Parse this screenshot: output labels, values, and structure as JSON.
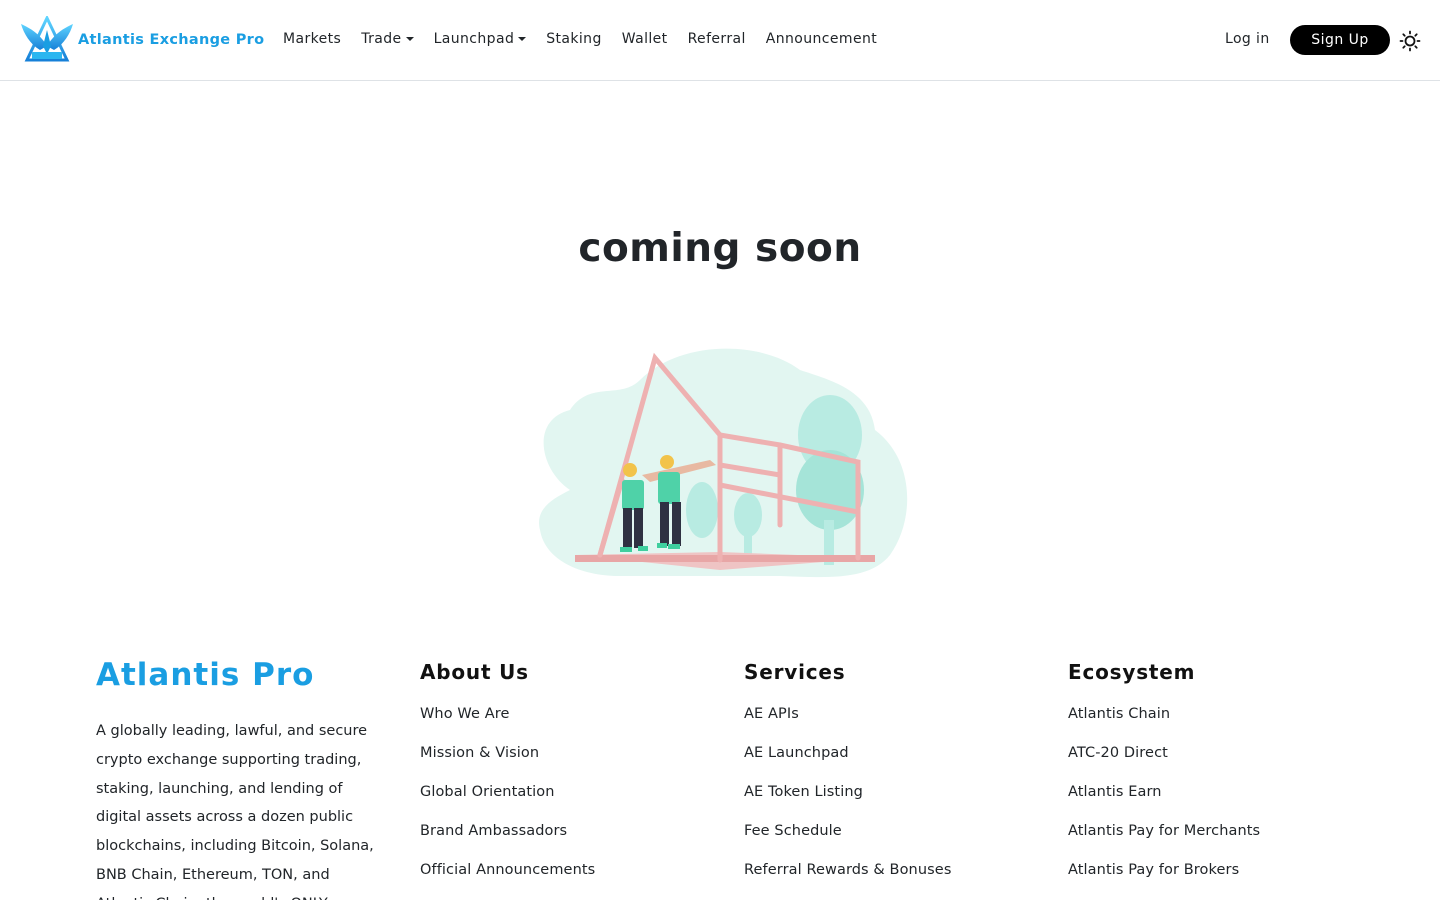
{
  "header": {
    "brand_name": "Atlantis Exchange Pro",
    "logo_icon": "atlantis-wings-triangle-logo",
    "nav": [
      {
        "label": "Markets",
        "dropdown": false
      },
      {
        "label": "Trade",
        "dropdown": true
      },
      {
        "label": "Launchpad",
        "dropdown": true
      },
      {
        "label": "Staking",
        "dropdown": false
      },
      {
        "label": "Wallet",
        "dropdown": false
      },
      {
        "label": "Referral",
        "dropdown": false
      },
      {
        "label": "Announcement",
        "dropdown": false
      }
    ],
    "login_label": "Log in",
    "signup_label": "Sign Up",
    "theme_icon": "sun-icon"
  },
  "main": {
    "heading": "coming soon",
    "illustration_icon": "construction-workers-house-frame"
  },
  "footer": {
    "brand_title": "Atlantis Pro",
    "description": "A globally leading, lawful, and secure crypto exchange supporting trading, staking, launching, and lending of digital assets across a dozen public blockchains, including Bitcoin, Solana, BNB Chain, Ethereum, TON, and Atlantis Chain, the world's ONLY",
    "columns": [
      {
        "title": "About Us",
        "links": [
          "Who We Are",
          "Mission & Vision",
          "Global Orientation",
          "Brand Ambassadors",
          "Official Announcements"
        ]
      },
      {
        "title": "Services",
        "links": [
          "AE APIs",
          "AE Launchpad",
          "AE Token Listing",
          "Fee Schedule",
          "Referral Rewards & Bonuses"
        ]
      },
      {
        "title": "Ecosystem",
        "links": [
          "Atlantis Chain",
          "ATC-20 Direct",
          "Atlantis Earn",
          "Atlantis Pay for Merchants",
          "Atlantis Pay for Brokers"
        ]
      }
    ]
  },
  "colors": {
    "brand_blue": "#1a9ee2",
    "signup_bg": "#000000",
    "divider": "#dee2e6"
  }
}
